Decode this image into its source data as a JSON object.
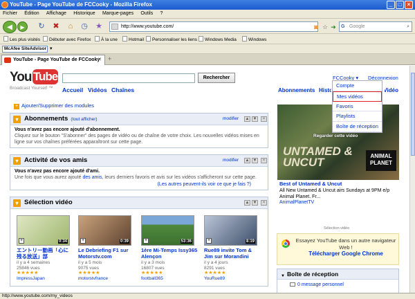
{
  "window": {
    "title": "YouTube - Page YouTube de FCCooky - Mozilla Firefox"
  },
  "menu": [
    "Fichier",
    "Édition",
    "Affichage",
    "Historique",
    "Marque-pages",
    "Outils",
    "?"
  ],
  "address": {
    "url": "http://www.youtube.com/",
    "search_placeholder": "Google"
  },
  "bookmarks": [
    "Les plus visités",
    "Débuter avec Firefox",
    "À la une",
    "Hotmail",
    "Personnaliser les liens",
    "Windows Media",
    "Windows"
  ],
  "mcafee": {
    "label": "McAfee SiteAdvisor"
  },
  "tab": {
    "title": "YouTube - Page YouTube de FCCooky",
    "new_tab": "+"
  },
  "yt": {
    "logo_you": "You",
    "logo_tube": "Tube",
    "tagline": "Broadcast Yourself ™",
    "search_button": "Rechercher",
    "nav": [
      "Accueil",
      "Vidéos",
      "Chaînes"
    ],
    "user": "FCCooky ▾",
    "logout": "Déconnexion",
    "right_nav": [
      "Abonnements",
      "Historique",
      "Vidéo"
    ],
    "dropdown": [
      "Compte",
      "Mes vidéos",
      "Favoris",
      "Playlists",
      "Boîte de réception"
    ]
  },
  "modules": {
    "add": "Ajouter/Supprimer des modules",
    "edit_label": "modifier",
    "subs": {
      "title": "Abonnements",
      "sub": "(tout afficher)",
      "bold": "Vous n'avez pas encore ajouté d'abonnement.",
      "text": "Cliquez sur le bouton \"S'abonner\" des pages de vidéo ou de chaîne de votre choix. Les nouvelles vidéos mises en ligne sur vos chaînes préférées apparaîtront sur cette page."
    },
    "friends": {
      "title": "Activité de vos amis",
      "bold": "Vous n'avez pas encore ajouté d'ami.",
      "text_pre": "Une fois que vous aurez ajouté",
      "link": "des amis",
      "text_post": ", leurs derniers favoris et avis sur les vidéos s'afficheront sur cette page.",
      "more": "(Les autres peuvent-ils voir ce que je fais ?)"
    },
    "videos": {
      "title": "Sélection vidéo",
      "items": [
        {
          "title": "エントリー動画「心に残る放送」部",
          "age": "il y a 4 semaines",
          "views": "25846 vues",
          "stars": "★★★★★",
          "user": "ImpressJapan",
          "duration": "0:34",
          "bg": "#b9c98f"
        },
        {
          "title": "Le Debriefing F1 sur Motorstv.com",
          "age": "il y a 5 mois",
          "views": "9075 vues",
          "stars": "★★★★★",
          "user": "motorstvfrance",
          "duration": "0:39",
          "bg": "#8a6a4a"
        },
        {
          "title": "1ère Mi-Temps Issy365 Alençon",
          "age": "il y a 3 mois",
          "views": "16807 vues",
          "stars": "★★★★★",
          "user": "football365",
          "duration": "53:36",
          "bg": "#4f8a3e"
        },
        {
          "title": "Rue89 invite Tom & Jim sur Morandini",
          "age": "il y a 4 jours",
          "views": "8291 vues",
          "stars": "★★★★★",
          "user": "YouRue89",
          "duration": "8:19",
          "bg": "#5b6f8e"
        }
      ]
    }
  },
  "right": {
    "ad_caption": "Regarder cette vidéo",
    "ad_untamed": "UNTAMED & UNCUT",
    "ad_animal": "ANIMAL PLANET",
    "ad_title": "Best of Untamed & Uncut",
    "ad_desc": "All New Untamed & Uncut airs Sundays at 9PM e/p Animal Planet. Fr...",
    "ad_channel": "AnimalPlanetTV",
    "ad_label": "Sélection vidéo",
    "chrome_line1": "Essayez YouTube dans un autre navigateur Web !",
    "chrome_line2": "Télécharger Google Chrome",
    "inbox_title": "Boîte de réception",
    "inbox_msg": "0 message personnel"
  },
  "status": "http://www.youtube.com/my_videos"
}
